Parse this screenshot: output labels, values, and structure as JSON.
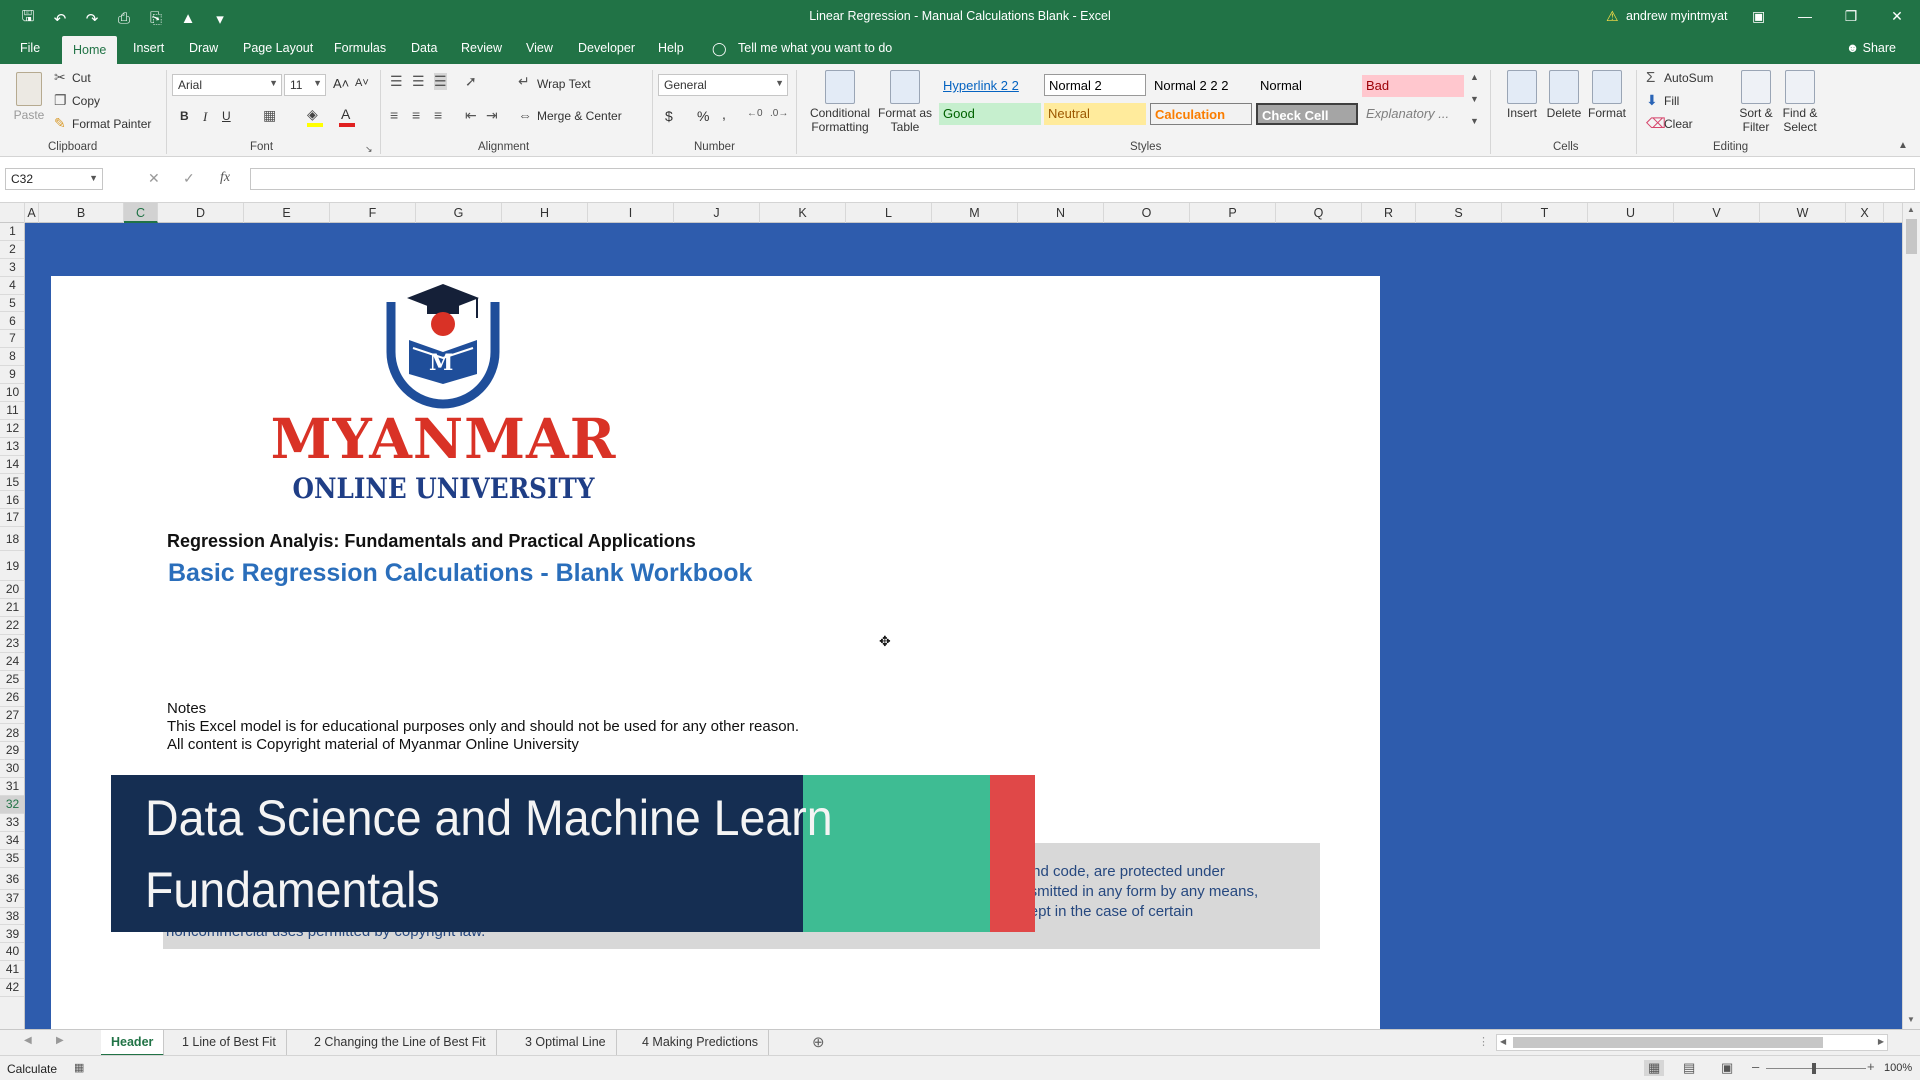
{
  "window": {
    "title": "Linear Regression - Manual Calculations Blank  -  Excel",
    "user": "andrew myintmyat"
  },
  "menu": {
    "tabs": [
      "File",
      "Home",
      "Insert",
      "Draw",
      "Page Layout",
      "Formulas",
      "Data",
      "Review",
      "View",
      "Developer",
      "Help"
    ],
    "tell_me": "Tell me what you want to do",
    "share": "Share"
  },
  "ribbon": {
    "clipboard": {
      "paste": "Paste",
      "cut": "Cut",
      "copy": "Copy",
      "format_painter": "Format Painter",
      "label": "Clipboard"
    },
    "font": {
      "name": "Arial",
      "size": "11",
      "bold": "B",
      "italic": "I",
      "underline": "U",
      "label": "Font"
    },
    "alignment": {
      "wrap_text": "Wrap Text",
      "merge_center": "Merge & Center",
      "label": "Alignment"
    },
    "number": {
      "format": "General",
      "currency": "$",
      "percent": "%",
      "comma": ",",
      "label": "Number"
    },
    "styles": {
      "conditional_formatting_1": "Conditional",
      "conditional_formatting_2": "Formatting",
      "format_as_table_1": "Format as",
      "format_as_table_2": "Table",
      "cells": [
        {
          "label": "Hyperlink 2 2",
          "fg": "#0563c1",
          "bg": "#f3f3f3"
        },
        {
          "label": "Normal 2",
          "fg": "#000000",
          "bg": "#ffffff"
        },
        {
          "label": "Normal 2 2 2",
          "fg": "#000000",
          "bg": "#f3f3f3"
        },
        {
          "label": "Normal",
          "fg": "#000000",
          "bg": "#f3f3f3"
        },
        {
          "label": "Bad",
          "fg": "#9c0006",
          "bg": "#ffc7ce"
        },
        {
          "label": "Good",
          "fg": "#006100",
          "bg": "#c6efce"
        },
        {
          "label": "Neutral",
          "fg": "#9c5700",
          "bg": "#ffeb9c"
        },
        {
          "label": "Calculation",
          "fg": "#fa7d00",
          "bg": "#f2f2f2"
        },
        {
          "label": "Check Cell",
          "fg": "#ffffff",
          "bg": "#a5a5a5"
        },
        {
          "label": "Explanatory ...",
          "fg": "#7f7f7f",
          "bg": "#f3f3f3"
        }
      ],
      "label": "Styles"
    },
    "cells": {
      "insert": "Insert",
      "delete": "Delete",
      "format": "Format",
      "label": "Cells"
    },
    "editing": {
      "autosum": "AutoSum",
      "fill": "Fill",
      "clear": "Clear",
      "sort_filter_1": "Sort &",
      "sort_filter_2": "Filter",
      "find_select_1": "Find &",
      "find_select_2": "Select",
      "label": "Editing"
    }
  },
  "formula_bar": {
    "name_box": "C32",
    "fx": "fx",
    "value": ""
  },
  "columns": [
    "A",
    "B",
    "C",
    "D",
    "E",
    "F",
    "G",
    "H",
    "I",
    "J",
    "K",
    "L",
    "M",
    "N",
    "O",
    "P",
    "Q",
    "R",
    "S",
    "T",
    "U",
    "V",
    "W",
    "X"
  ],
  "rows": [
    "1",
    "2",
    "3",
    "4",
    "5",
    "6",
    "7",
    "8",
    "9",
    "10",
    "11",
    "12",
    "13",
    "14",
    "15",
    "16",
    "17",
    "18",
    "19",
    "20",
    "21",
    "22",
    "23",
    "24",
    "25",
    "26",
    "27",
    "28",
    "29",
    "30",
    "31",
    "32",
    "33",
    "34",
    "35",
    "36",
    "37",
    "38",
    "39",
    "40",
    "41",
    "42"
  ],
  "selected_cell": {
    "column": "C",
    "row": "32"
  },
  "document": {
    "logo_line1": "MYANMAR",
    "logo_line2": "ONLINE UNIVERSITY",
    "logo_letter": "M",
    "heading": "Regression Analyis: Fundamentals and Practical Applications",
    "subheading": "Basic Regression Calculations - Blank Workbook",
    "notes_title": "Notes",
    "note_1": "This Excel model is for educational purposes only and should not be used for any other reason.",
    "note_2": "All content is Copyright material of Myanmar Online University",
    "copyright_line1_end": "s, and code, are protected under",
    "copyright_line2_end": "ransmitted in any form by any means,",
    "copyright_line3": "including photocopying, recording, or other electronic or mechanical methods, without prior written permission of the publisher, except in the case of certain",
    "copyright_line4": "noncommercial uses permitted by copyright law."
  },
  "overlay_banner": {
    "line1": "Data Science and Machine Learn",
    "line2": "Fundamentals",
    "colors": {
      "navy": "#152e52",
      "teal": "#3ebc93",
      "red": "#e04848"
    }
  },
  "sheet_tabs": [
    "Header",
    "1 Line of Best Fit",
    "2 Changing the Line of Best Fit",
    "3 Optimal Line",
    "4 Making Predictions"
  ],
  "status": {
    "mode": "Calculate",
    "zoom": "100%"
  }
}
